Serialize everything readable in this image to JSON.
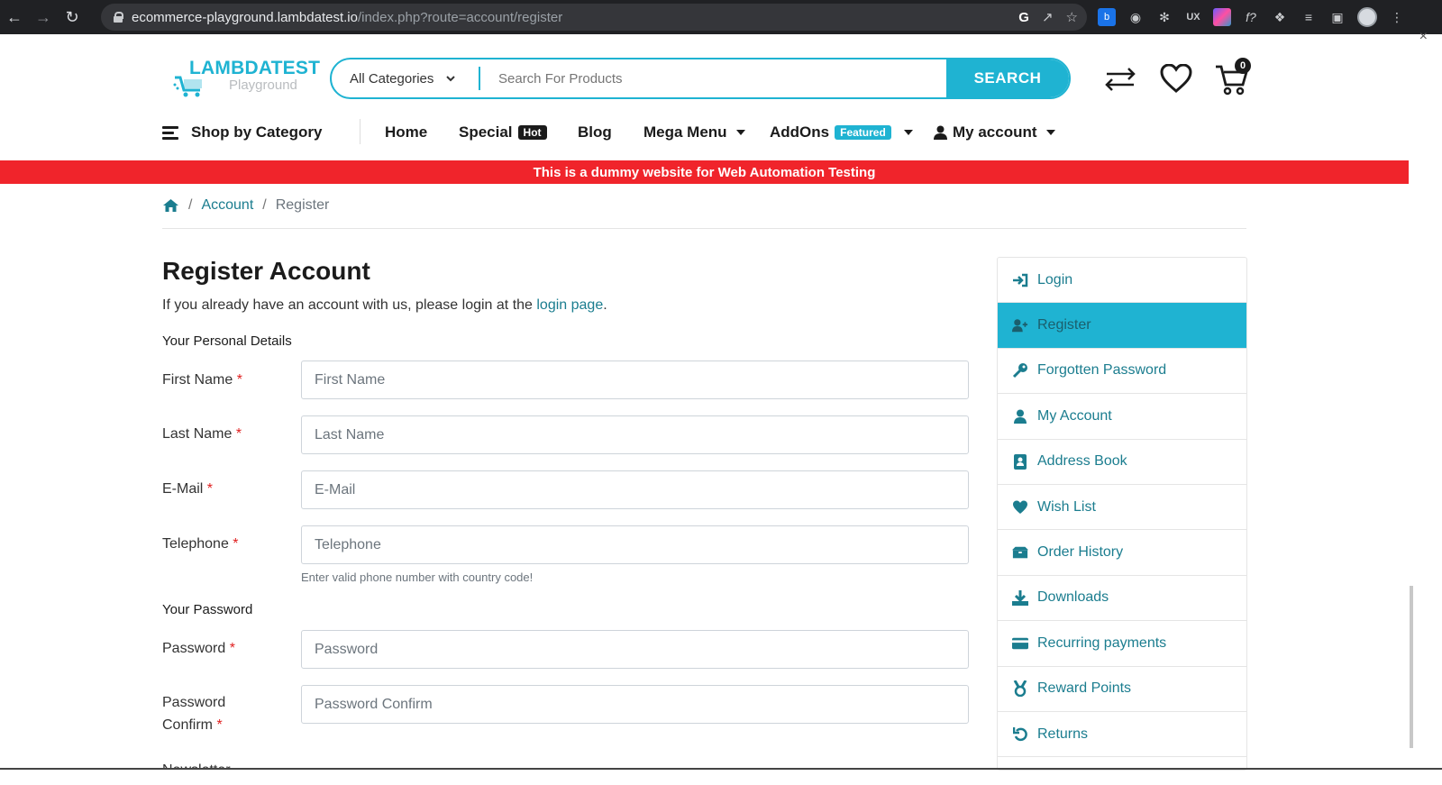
{
  "browser": {
    "url_host": "ecommerce-playground.lambdatest.io",
    "url_path": "/index.php?route=account/register"
  },
  "logo": {
    "title": "LAMBDATEST",
    "subtitle": "Playground"
  },
  "search": {
    "category": "All Categories",
    "placeholder": "Search For Products",
    "button": "SEARCH"
  },
  "cart": {
    "count": "0"
  },
  "menu": {
    "shop_by_category": "Shop by Category",
    "home": "Home",
    "special": "Special",
    "special_badge": "Hot",
    "blog": "Blog",
    "mega_menu": "Mega Menu",
    "addons": "AddOns",
    "addons_badge": "Featured",
    "my_account": "My account"
  },
  "banner": "This is a dummy website for Web Automation Testing",
  "breadcrumb": {
    "account": "Account",
    "current": "Register"
  },
  "form": {
    "title": "Register Account",
    "intro_prefix": "If you already have an account with us, please login at the ",
    "intro_link": "login page",
    "intro_suffix": ".",
    "personal_legend": "Your Personal Details",
    "first_name_label": "First Name",
    "first_name_placeholder": "First Name",
    "last_name_label": "Last Name",
    "last_name_placeholder": "Last Name",
    "email_label": "E-Mail",
    "email_placeholder": "E-Mail",
    "telephone_label": "Telephone",
    "telephone_placeholder": "Telephone",
    "telephone_help": "Enter valid phone number with country code!",
    "password_legend": "Your Password",
    "password_label": "Password",
    "password_placeholder": "Password",
    "confirm_label_1": "Password",
    "confirm_label_2": "Confirm",
    "confirm_placeholder": "Password Confirm",
    "required_mark": "*",
    "next_legend": "Newsletter"
  },
  "sidebar": {
    "items": [
      {
        "label": "Login",
        "icon": "sign-in-icon"
      },
      {
        "label": "Register",
        "icon": "user-plus-icon"
      },
      {
        "label": "Forgotten Password",
        "icon": "key-icon"
      },
      {
        "label": "My Account",
        "icon": "user-icon"
      },
      {
        "label": "Address Book",
        "icon": "address-book-icon"
      },
      {
        "label": "Wish List",
        "icon": "heart-icon"
      },
      {
        "label": "Order History",
        "icon": "boxes-icon"
      },
      {
        "label": "Downloads",
        "icon": "download-icon"
      },
      {
        "label": "Recurring payments",
        "icon": "credit-card-icon"
      },
      {
        "label": "Reward Points",
        "icon": "medal-icon"
      },
      {
        "label": "Returns",
        "icon": "undo-icon"
      }
    ]
  },
  "colors": {
    "accent": "#1fb3d2",
    "banner": "#f0242b",
    "link": "#1b7d8f"
  }
}
